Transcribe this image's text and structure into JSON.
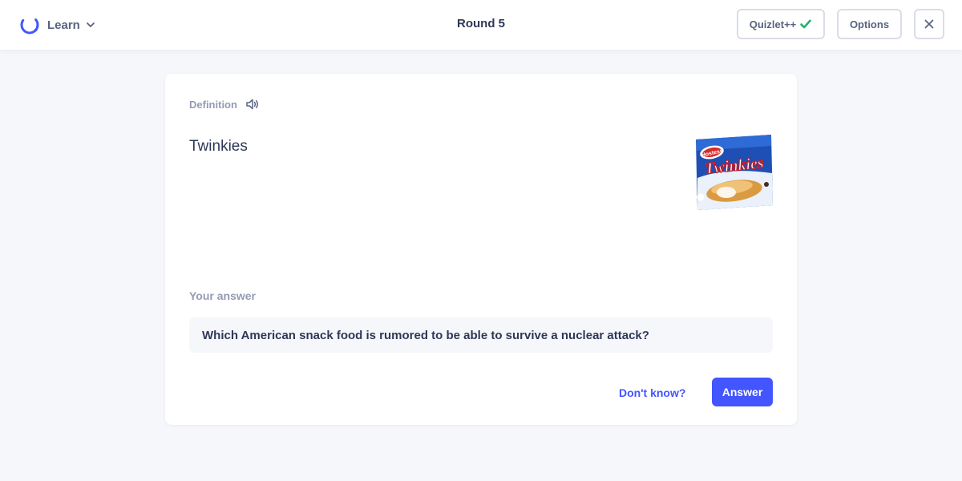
{
  "header": {
    "mode_label": "Learn",
    "round_title": "Round 5",
    "quizlet_plus_label": "Quizlet++",
    "options_label": "Options"
  },
  "question": {
    "prompt_label": "Definition",
    "term": "Twinkies",
    "image": {
      "brand": "Hostess",
      "product": "Twinkies"
    }
  },
  "answer": {
    "label": "Your answer",
    "value": "Which American snack food is rumored to be able to survive a nuclear attack?",
    "dont_know_label": "Don't know?",
    "submit_label": "Answer"
  },
  "colors": {
    "accent": "#4255ff",
    "background": "#f6f7fb",
    "check_green": "#23b26d",
    "muted_text": "#939bb4",
    "text": "#2e3856"
  },
  "icons": {
    "mode": "learn-progress-icon",
    "dropdown": "chevron-down-icon",
    "plus_status": "check-icon",
    "close": "close-icon",
    "audio": "speaker-icon"
  }
}
